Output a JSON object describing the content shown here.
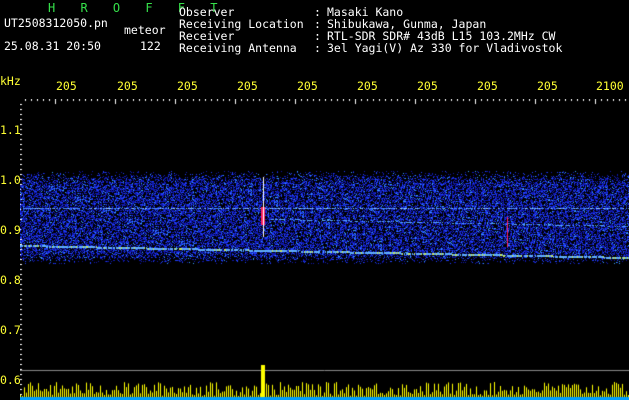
{
  "header": {
    "app_name": "H R O F F T",
    "file_name": "UT2508312050.pn",
    "tag": "meteor",
    "date_time": "25.08.31 20:50",
    "count": "122"
  },
  "meta": {
    "separator": ":",
    "rows": [
      {
        "label": "Observer",
        "value": "Masaki Kano"
      },
      {
        "label": "Receiving Location",
        "value": "Shibukawa, Gunma, Japan"
      },
      {
        "label": "Receiver",
        "value": "RTL-SDR SDR# 43dB L15 103.2MHz CW"
      },
      {
        "label": "Receiving Antenna",
        "value": "3el Yagi(V) Az 330 for Vladivostok"
      }
    ]
  },
  "spectrogram": {
    "y_unit": "kHz",
    "x_ticks": [
      "205",
      "205",
      "205",
      "205",
      "205",
      "205",
      "205",
      "205",
      "205",
      "2100"
    ],
    "y_ticks": [
      "1.1",
      "1.0",
      "0.9",
      "0.8",
      "0.7",
      "0.6"
    ],
    "colors": {
      "text": "#ffff33",
      "tick": "#ffffff",
      "noise": "#1a33ff",
      "signal": "#ff2060",
      "meter": "#ffff00",
      "meter_base": "#00a0ff"
    }
  }
}
